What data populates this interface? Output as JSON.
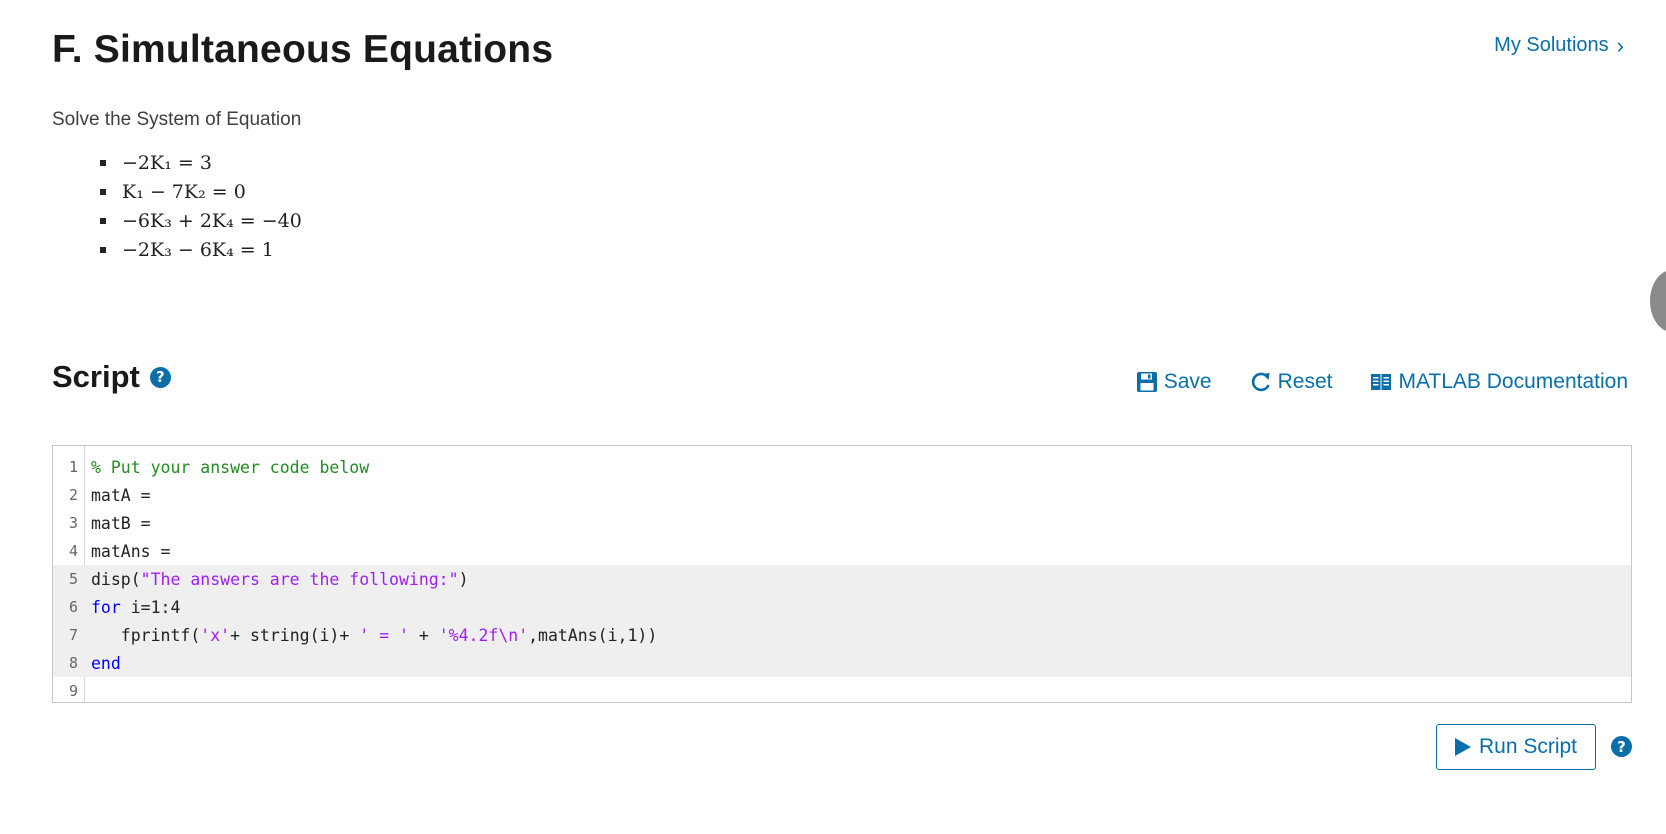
{
  "page": {
    "title": "F. Simultaneous Equations",
    "my_solutions": "My Solutions",
    "intro": "Solve the System of Equation"
  },
  "equations": [
    "−2K₁ = 3",
    "K₁ − 7K₂ = 0",
    "−6K₃ + 2K₄ = −40",
    "−2K₃ − 6K₄ = 1"
  ],
  "script": {
    "heading": "Script",
    "help": "?",
    "toolbar": {
      "save": "Save",
      "reset": "Reset",
      "docs": "MATLAB Documentation"
    }
  },
  "editor": {
    "line_numbers": [
      "1",
      "2",
      "3",
      "4",
      "5",
      "6",
      "7",
      "8",
      "9"
    ],
    "code": {
      "l1": "% Put your answer code below",
      "l2": "matA =",
      "l3": "matB =",
      "l4": "matAns =",
      "l5_a": "disp(",
      "l5_s": "\"The answers are the following:\"",
      "l5_b": ")",
      "l6_kw": "for",
      "l6_rest": " i=1:4",
      "l7_a": "   fprintf(",
      "l7_s1": "'x'",
      "l7_b": "+ string(i)+ ",
      "l7_s2": "' = '",
      "l7_c": " + ",
      "l7_s3": "'%4.2f\\n'",
      "l7_d": ",matAns(i,1))",
      "l8_kw": "end"
    }
  },
  "run": {
    "label": "Run Script",
    "help": "?"
  },
  "colors": {
    "accent": "#0a6fa8",
    "comment": "#228b22",
    "string": "#a020f0",
    "keyword": "#0000ff"
  }
}
